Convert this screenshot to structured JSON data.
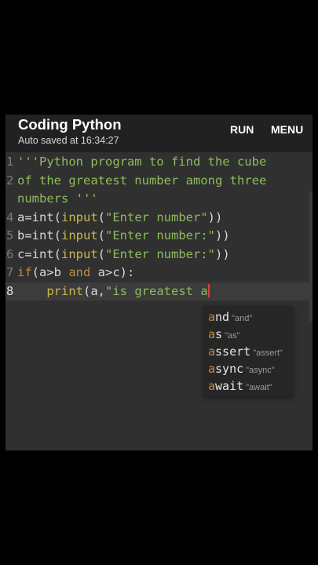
{
  "appbar": {
    "title": "Coding Python",
    "subtitle": "Auto saved at 16:34:27",
    "run_label": "RUN",
    "menu_label": "MENU"
  },
  "editor": {
    "lines": [
      {
        "num": "1",
        "tokens": [
          {
            "t": "'''Python program to find the cube",
            "c": "cm"
          }
        ]
      },
      {
        "num": "2",
        "tokens": [
          {
            "t": "of the greatest number among three",
            "c": "cm"
          }
        ]
      },
      {
        "num": "",
        "tokens": [
          {
            "t": "numbers '''",
            "c": "cm"
          }
        ]
      },
      {
        "num": "4",
        "tokens": [
          {
            "t": "a=int(",
            "c": "tx"
          },
          {
            "t": "input",
            "c": "fn"
          },
          {
            "t": "(",
            "c": "tx"
          },
          {
            "t": "\"Enter number\"",
            "c": "st"
          },
          {
            "t": "))",
            "c": "tx"
          }
        ]
      },
      {
        "num": "5",
        "tokens": [
          {
            "t": "b=int(",
            "c": "tx"
          },
          {
            "t": "input",
            "c": "fn"
          },
          {
            "t": "(",
            "c": "tx"
          },
          {
            "t": "\"Enter number:\"",
            "c": "st"
          },
          {
            "t": "))",
            "c": "tx"
          }
        ]
      },
      {
        "num": "6",
        "tokens": [
          {
            "t": "c=int(",
            "c": "tx"
          },
          {
            "t": "input",
            "c": "fn"
          },
          {
            "t": "(",
            "c": "tx"
          },
          {
            "t": "\"Enter number:\"",
            "c": "st"
          },
          {
            "t": "))",
            "c": "tx"
          }
        ]
      },
      {
        "num": "7",
        "tokens": [
          {
            "t": "if",
            "c": "kw"
          },
          {
            "t": "(a>b ",
            "c": "tx"
          },
          {
            "t": "and",
            "c": "kw"
          },
          {
            "t": " a>c):",
            "c": "tx"
          }
        ]
      },
      {
        "num": "8",
        "current": true,
        "tokens": [
          {
            "t": "    ",
            "c": "tx"
          },
          {
            "t": "print",
            "c": "fn"
          },
          {
            "t": "(a,",
            "c": "tx"
          },
          {
            "t": "\"is greatest a",
            "c": "st"
          }
        ]
      }
    ]
  },
  "autocomplete": {
    "items": [
      {
        "match": "a",
        "rest": "nd",
        "hint": "\"and\""
      },
      {
        "match": "a",
        "rest": "s",
        "hint": "\"as\""
      },
      {
        "match": "a",
        "rest": "ssert",
        "hint": "\"assert\""
      },
      {
        "match": "a",
        "rest": "sync",
        "hint": "\"async\""
      },
      {
        "match": "a",
        "rest": "wait",
        "hint": "\"await\""
      }
    ]
  },
  "colors": {
    "background": "#000000",
    "appbar": "#212121",
    "editor": "#303030",
    "comment_string": "#8dbd5b",
    "keyword": "#c58a3f",
    "builtin": "#c9b84f",
    "cursor": "#e03c3c"
  }
}
